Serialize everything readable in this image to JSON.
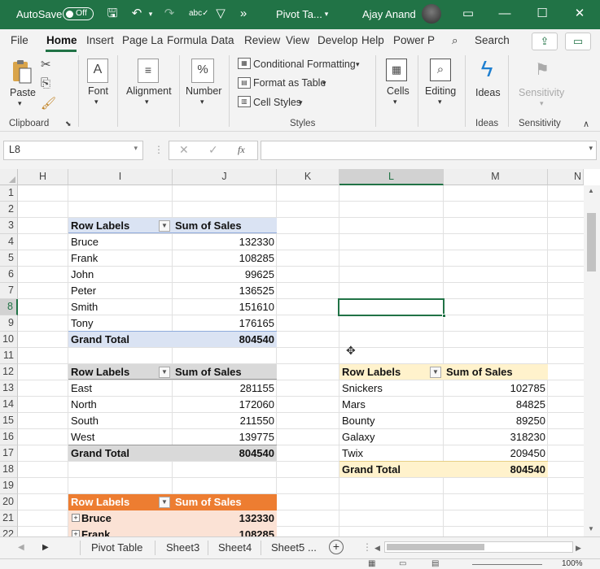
{
  "titlebar": {
    "autosave_label": "AutoSave",
    "autosave_state": "Off",
    "doc_title": "Pivot Ta...",
    "user_name": "Ajay Anand",
    "accent_color": "#217346"
  },
  "tabs": [
    "File",
    "Home",
    "Insert",
    "Page La",
    "Formula",
    "Data",
    "Review",
    "View",
    "Develop",
    "Help",
    "Power P"
  ],
  "active_tab": "Home",
  "search_label": "Search",
  "ribbon": {
    "clipboard": {
      "paste": "Paste",
      "group": "Clipboard"
    },
    "font": {
      "label": "Font"
    },
    "alignment": {
      "label": "Alignment"
    },
    "number": {
      "label": "Number"
    },
    "styles": {
      "conditional": "Conditional Formatting",
      "format_table": "Format as Table",
      "cell_styles": "Cell Styles",
      "group": "Styles"
    },
    "cells": {
      "label": "Cells"
    },
    "editing": {
      "label": "Editing"
    },
    "ideas": {
      "label": "Ideas",
      "group": "Ideas"
    },
    "sensitivity": {
      "label": "Sensitivity",
      "group": "Sensitivity"
    }
  },
  "formula_bar": {
    "name_box": "L8",
    "formula": ""
  },
  "columns": [
    "H",
    "I",
    "J",
    "K",
    "L",
    "M",
    "N"
  ],
  "rows": [
    "1",
    "2",
    "3",
    "4",
    "5",
    "6",
    "7",
    "8",
    "9",
    "10",
    "11",
    "12",
    "13",
    "14",
    "15",
    "16",
    "17",
    "18",
    "19",
    "20",
    "21",
    "22"
  ],
  "pivot1": {
    "header": [
      "Row Labels",
      "Sum of Sales"
    ],
    "rows": [
      [
        "Bruce",
        "132330"
      ],
      [
        "Frank",
        "108285"
      ],
      [
        "John",
        "99625"
      ],
      [
        "Peter",
        "136525"
      ],
      [
        "Smith",
        "151610"
      ],
      [
        "Tony",
        "176165"
      ]
    ],
    "total": [
      "Grand Total",
      "804540"
    ],
    "color": "#dae3f3"
  },
  "pivot2": {
    "header": [
      "Row Labels",
      "Sum of Sales"
    ],
    "rows": [
      [
        "East",
        "281155"
      ],
      [
        "North",
        "172060"
      ],
      [
        "South",
        "211550"
      ],
      [
        "West",
        "139775"
      ]
    ],
    "total": [
      "Grand Total",
      "804540"
    ],
    "color": "#d9d9d9"
  },
  "pivot3": {
    "header": [
      "Row Labels",
      "Sum of Sales"
    ],
    "rows": [
      [
        "Snickers",
        "102785"
      ],
      [
        "Mars",
        "84825"
      ],
      [
        "Bounty",
        "89250"
      ],
      [
        "Galaxy",
        "318230"
      ],
      [
        "Twix",
        "209450"
      ]
    ],
    "total": [
      "Grand Total",
      "804540"
    ],
    "color": "#fff2cc"
  },
  "pivot4": {
    "header": [
      "Row Labels",
      "Sum of Sales"
    ],
    "rows": [
      [
        "Bruce",
        "132330"
      ],
      [
        "Frank",
        "108285"
      ]
    ],
    "header_color": "#ed7d31",
    "row_color": "#fbe2d5"
  },
  "sheets": [
    "Pivot Table",
    "Sheet3",
    "Sheet4",
    "Sheet5",
    "..."
  ],
  "status": {
    "zoom": "100%"
  }
}
